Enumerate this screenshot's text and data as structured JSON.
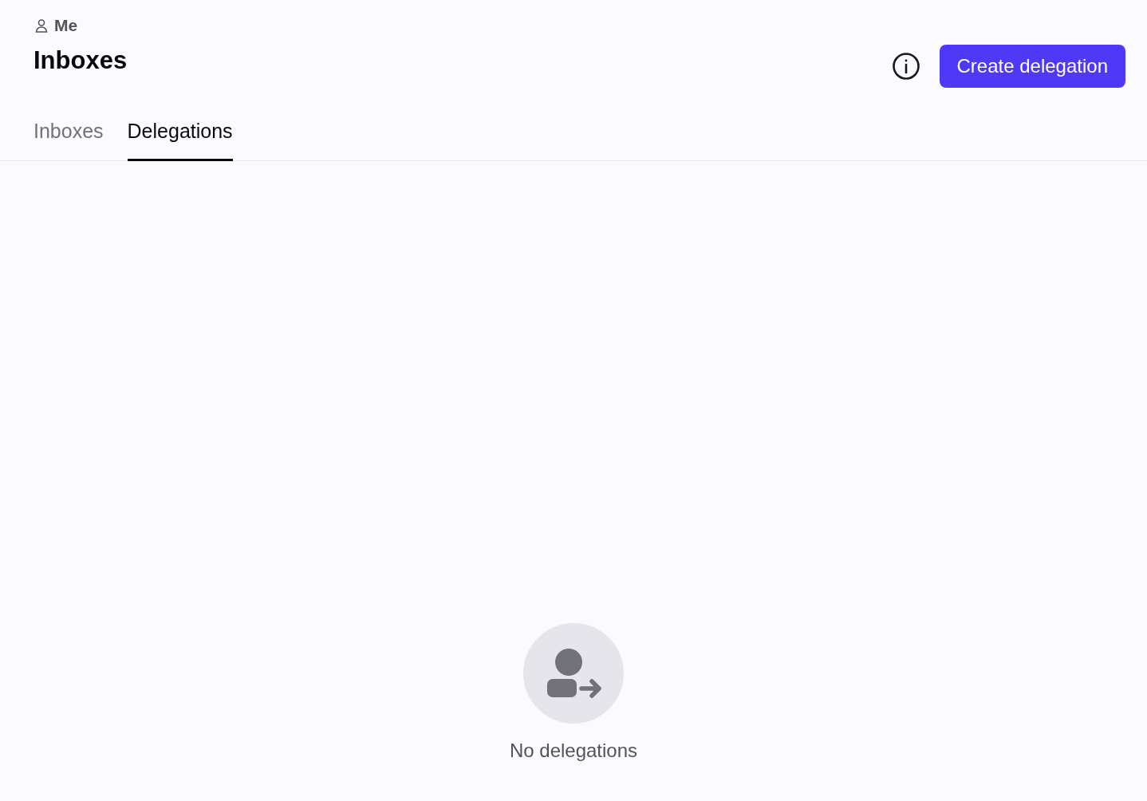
{
  "breadcrumb": {
    "label": "Me"
  },
  "title": "Inboxes",
  "create_button": {
    "label": "Create delegation"
  },
  "tabs": [
    {
      "label": "Inboxes",
      "selected": false
    },
    {
      "label": "Delegations",
      "selected": true
    }
  ],
  "empty_state": {
    "message": "No delegations"
  }
}
